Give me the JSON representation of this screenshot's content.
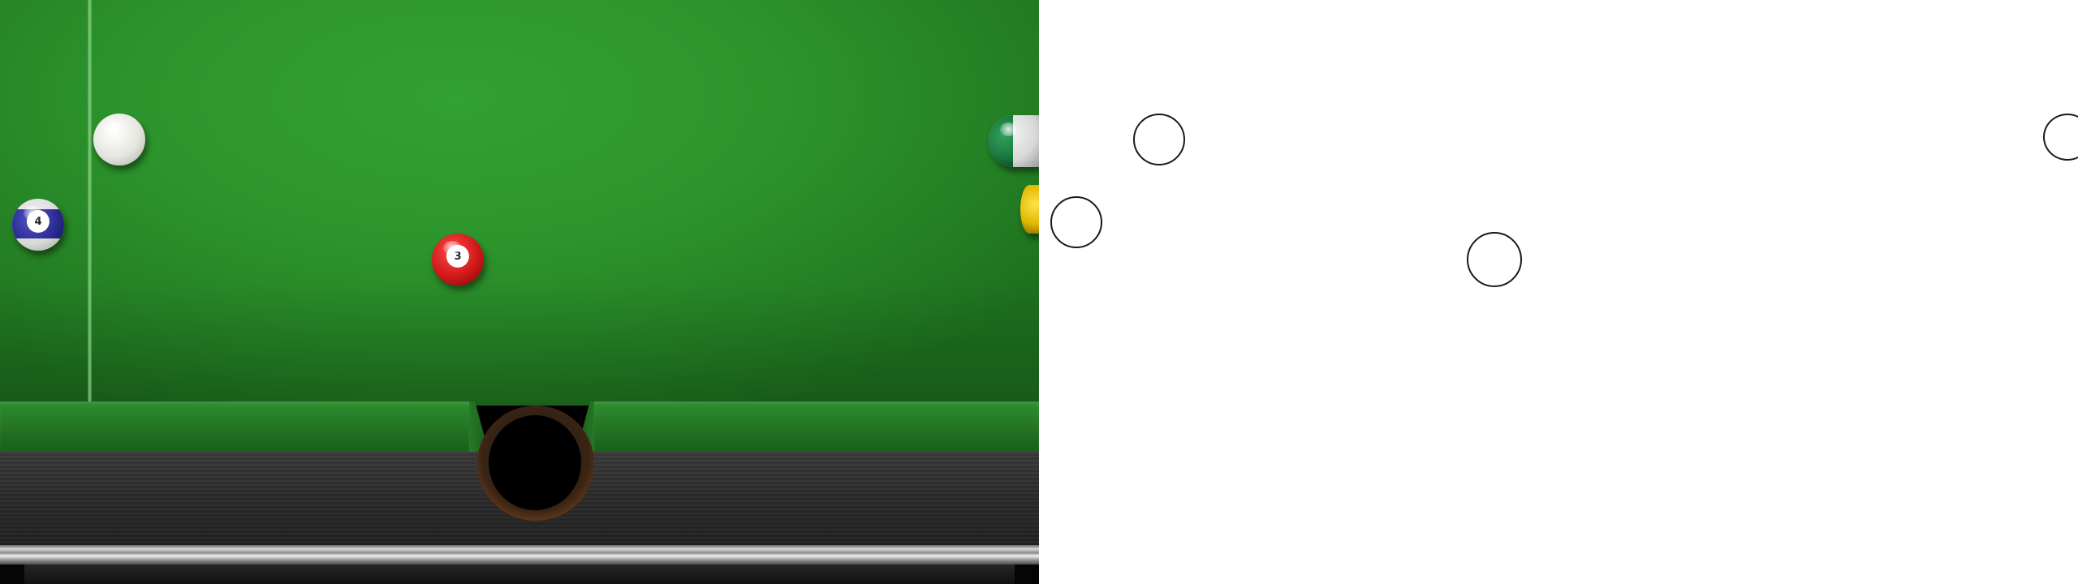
{
  "table": {
    "felt_color": "#2c942c",
    "rail_color": "#2c2c2c",
    "pocket": "bottom-center-pocket"
  },
  "balls": [
    {
      "id": "cue",
      "label": "",
      "color": "#ffffff"
    },
    {
      "id": "4",
      "label": "4",
      "color": "#2e2e9a",
      "style": "stripe"
    },
    {
      "id": "3",
      "label": "3",
      "color": "#d01818",
      "style": "solid"
    },
    {
      "id": "green",
      "label": "",
      "color": "#1a7a40",
      "style": "stripe",
      "partially_visible": true
    },
    {
      "id": "yellow",
      "label": "",
      "color": "#e0b800",
      "style": "solid",
      "partially_visible": true
    }
  ],
  "outlines": [
    {
      "id": "cue-outline"
    },
    {
      "id": "4-outline"
    },
    {
      "id": "3-outline"
    },
    {
      "id": "green-outline"
    }
  ]
}
